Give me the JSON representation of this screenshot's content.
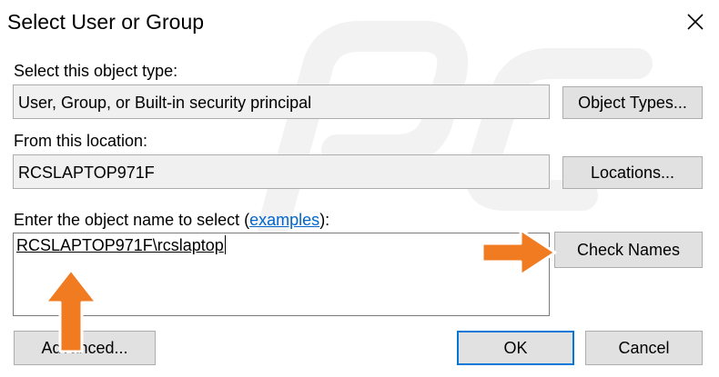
{
  "window": {
    "title": "Select User or Group",
    "close_icon": "close-icon"
  },
  "object_type": {
    "label": "Select this object type:",
    "value": "User, Group, or Built-in security principal",
    "button_label": "Object Types..."
  },
  "location": {
    "label": "From this location:",
    "value": "RCSLAPTOP971F",
    "button_label": "Locations..."
  },
  "object_name": {
    "label_prefix": "Enter the object name to select (",
    "link_label": "examples",
    "label_suffix": "):",
    "value": "RCSLAPTOP971F\\rcslaptop",
    "check_names_label": "Check Names"
  },
  "footer": {
    "advanced_label": "Advanced...",
    "ok_label": "OK",
    "cancel_label": "Cancel"
  },
  "annotations": {
    "arrow_color": "#f07b20",
    "arrow_outline": "#ffffff",
    "icons": [
      "arrow-up-icon",
      "arrow-right-icon"
    ]
  },
  "colors": {
    "link": "#0066cc",
    "default_button_border": "#0078d7",
    "readonly_background": "#f0f0f0",
    "button_background": "#e1e1e1"
  }
}
